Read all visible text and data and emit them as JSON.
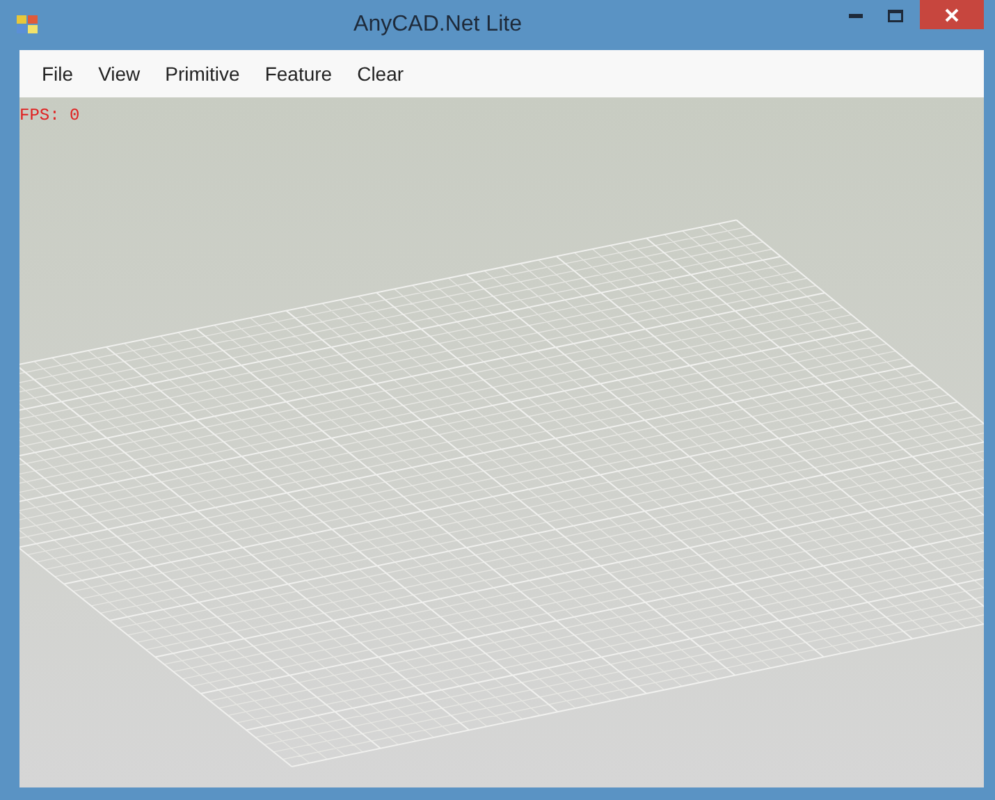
{
  "window": {
    "title": "AnyCAD.Net Lite"
  },
  "menu": [
    {
      "label": "File"
    },
    {
      "label": "View"
    },
    {
      "label": "Primitive"
    },
    {
      "label": "Feature"
    },
    {
      "label": "Clear"
    }
  ],
  "viewport": {
    "fps": "FPS: 0"
  }
}
